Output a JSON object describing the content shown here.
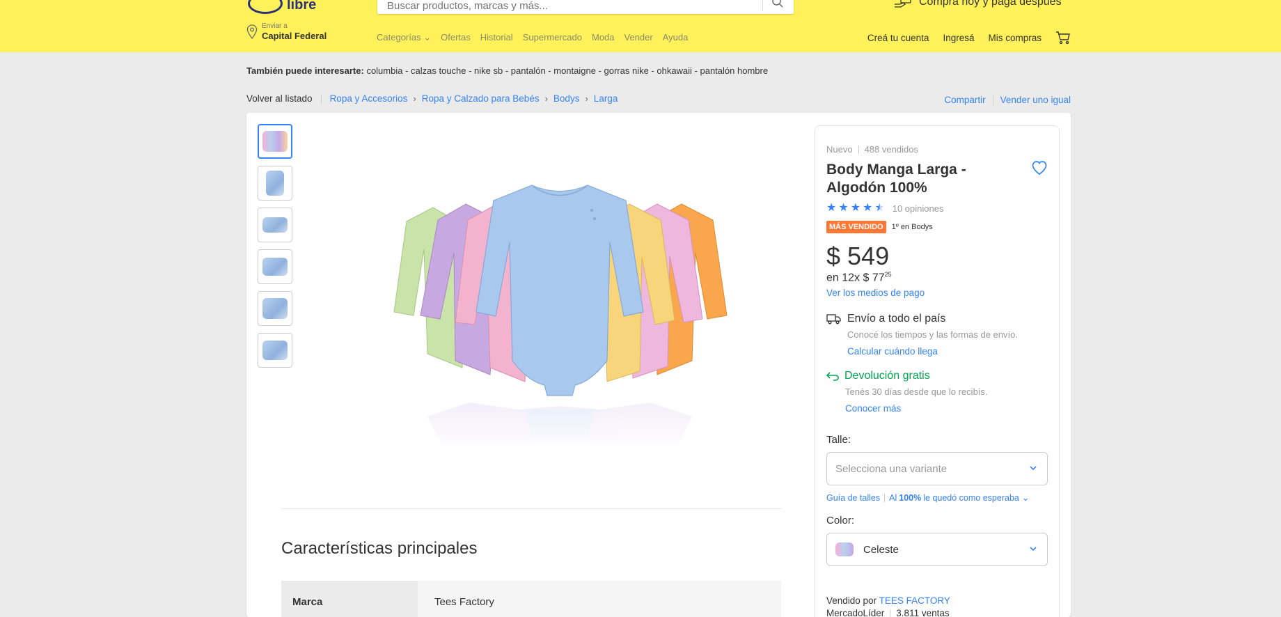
{
  "header": {
    "logo_text": "libre",
    "search_placeholder": "Buscar productos, marcas y más...",
    "promo": "Compra hoy y pagá después",
    "location_label": "Enviar a",
    "location_value": "Capital Federal",
    "nav": [
      "Categorías ⌄",
      "Ofertas",
      "Historial",
      "Supermercado",
      "Moda",
      "Vender",
      "Ayuda"
    ],
    "account_links": [
      "Creá tu cuenta",
      "Ingresá",
      "Mis compras"
    ]
  },
  "also_interest": {
    "label": "También puede interesarte:",
    "items": "columbia - calzas touche - nike sb - pantalón - montaigne - gorras nike - ohkawaii - pantalón hombre"
  },
  "breadcrumb": {
    "back": "Volver al listado",
    "items": [
      "Ropa y Accesorios",
      "Ropa y Calzado para Bebés",
      "Bodys",
      "Larga"
    ]
  },
  "actions": {
    "share": "Compartir",
    "sell_same": "Vender uno igual"
  },
  "product": {
    "condition": "Nuevo",
    "sold": "488 vendidos",
    "title": "Body Manga Larga - Algodón 100%",
    "rating": 4.5,
    "reviews": "10 opiniones",
    "badge": "MÁS VENDIDO",
    "badge_rank": "1º en Bodys",
    "price_symbol": "$",
    "price": "549",
    "installments": "en 12x $ 77",
    "installments_cents": "25",
    "payment_link": "Ver los medios de pago",
    "shipping_title": "Envío a todo el país",
    "shipping_sub": "Conocé los tiempos y las formas de envío.",
    "shipping_link": "Calcular cuándo llega",
    "return_title": "Devolución gratis",
    "return_sub": "Tenés 30 días desde que lo recibís.",
    "return_link": "Conocer más",
    "size_label": "Talle:",
    "size_placeholder": "Selecciona una variante",
    "size_guide": "Guía de talles",
    "size_fit_pre": "Al",
    "size_fit_pct": "100%",
    "size_fit_post": "le quedó como esperaba",
    "color_label": "Color:",
    "color_value": "Celeste",
    "sold_by_label": "Vendido por",
    "seller": "TEES FACTORY",
    "leader": "MercadoLíder",
    "seller_sales": "3.811 ventas"
  },
  "specs": {
    "title": "Características principales",
    "rows": [
      {
        "key": "Marca",
        "value": "Tees Factory"
      }
    ]
  },
  "colors": {
    "accent": "#3483fa",
    "header_bg": "#fff159",
    "green": "#00a650",
    "badge": "#ff7733"
  }
}
